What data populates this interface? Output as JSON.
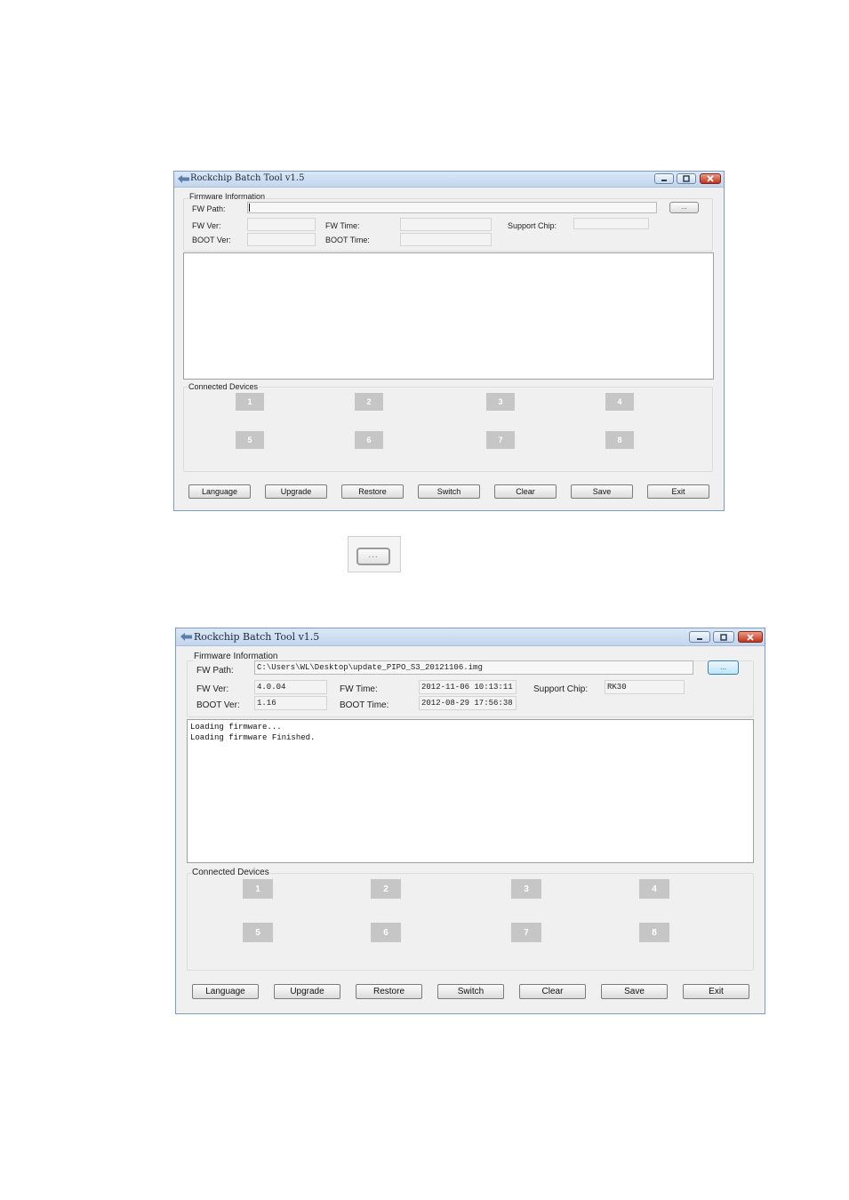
{
  "window_empty": {
    "title": "Rockchip Batch Tool v1.5",
    "firmware_info": {
      "group_label": "Firmware Information",
      "fw_path_label": "FW Path:",
      "fw_path_value": "",
      "browse_label": "...",
      "fw_ver_label": "FW Ver:",
      "fw_ver_value": "",
      "fw_time_label": "FW Time:",
      "fw_time_value": "",
      "support_chip_label": "Support Chip:",
      "support_chip_value": "",
      "boot_ver_label": "BOOT Ver:",
      "boot_ver_value": "",
      "boot_time_label": "BOOT Time:",
      "boot_time_value": ""
    },
    "log_lines": [],
    "connected_devices": {
      "group_label": "Connected Devices",
      "slots": [
        "1",
        "2",
        "3",
        "4",
        "5",
        "6",
        "7",
        "8"
      ]
    },
    "buttons": {
      "language": "Language",
      "upgrade": "Upgrade",
      "restore": "Restore",
      "switch": "Switch",
      "clear": "Clear",
      "save": "Save",
      "exit": "Exit"
    }
  },
  "browse_button_zoom": {
    "label": "..."
  },
  "window_loaded": {
    "title": "Rockchip Batch Tool v1.5",
    "firmware_info": {
      "group_label": "Firmware Information",
      "fw_path_label": "FW Path:",
      "fw_path_value": "C:\\Users\\WL\\Desktop\\update_PIPO_S3_20121106.img",
      "browse_label": "...",
      "fw_ver_label": "FW Ver:",
      "fw_ver_value": "4.0.04",
      "fw_time_label": "FW Time:",
      "fw_time_value": "2012-11-06 10:13:11",
      "support_chip_label": "Support Chip:",
      "support_chip_value": "RK30",
      "boot_ver_label": "BOOT Ver:",
      "boot_ver_value": "1.16",
      "boot_time_label": "BOOT Time:",
      "boot_time_value": "2012-08-29 17:56:38"
    },
    "log_lines": [
      "Loading firmware...",
      "Loading firmware Finished."
    ],
    "connected_devices": {
      "group_label": "Connected Devices",
      "slots": [
        "1",
        "2",
        "3",
        "4",
        "5",
        "6",
        "7",
        "8"
      ]
    },
    "buttons": {
      "language": "Language",
      "upgrade": "Upgrade",
      "restore": "Restore",
      "switch": "Switch",
      "clear": "Clear",
      "save": "Save",
      "exit": "Exit"
    }
  }
}
